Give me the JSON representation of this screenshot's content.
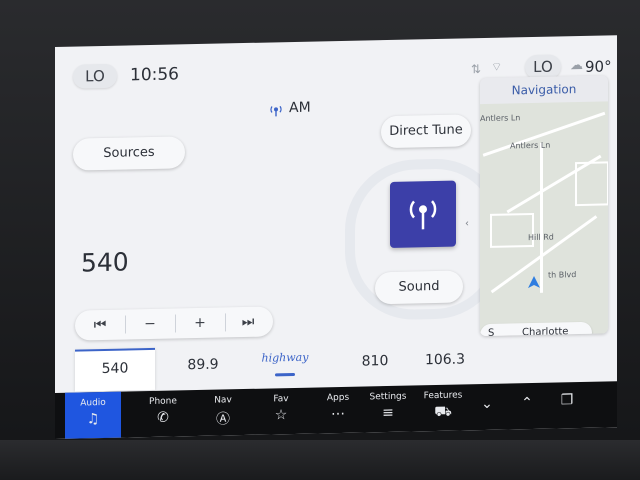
{
  "status": {
    "left_climate": "LO",
    "time": "10:56",
    "right_climate": "LO",
    "outside_temp": "90°"
  },
  "audio": {
    "source_label": "AM",
    "sources_button": "Sources",
    "direct_tune_button": "Direct Tune",
    "sound_button": "Sound",
    "frequency": "540",
    "controls": {
      "prev": "⏮",
      "minus": "−",
      "plus": "+",
      "next": "⏭"
    },
    "presets": [
      "540",
      "89.9",
      "highway",
      "810",
      "106.3"
    ]
  },
  "navigation": {
    "title": "Navigation",
    "search_prefix": "S",
    "search_value": "Charlotte",
    "map_labels": [
      "Antlers Ln",
      "Antlers Ln",
      "Hill Rd",
      "th Blvd"
    ]
  },
  "bottom_nav": {
    "items": [
      {
        "label": "Audio",
        "icon": "♫"
      },
      {
        "label": "Phone",
        "icon": "✆"
      },
      {
        "label": "Nav",
        "icon": "Ⓐ"
      },
      {
        "label": "Fav",
        "icon": "☆"
      },
      {
        "label": "Apps",
        "icon": "⋯"
      },
      {
        "label": "Settings",
        "icon": "≡"
      },
      {
        "label": "Features",
        "icon": "⛟"
      }
    ],
    "extra": [
      "⌄",
      "⌃",
      "❐"
    ]
  },
  "colors": {
    "accent": "#1f56e0",
    "tile": "#3c3fa8",
    "nav_title": "#3a5ca8"
  }
}
